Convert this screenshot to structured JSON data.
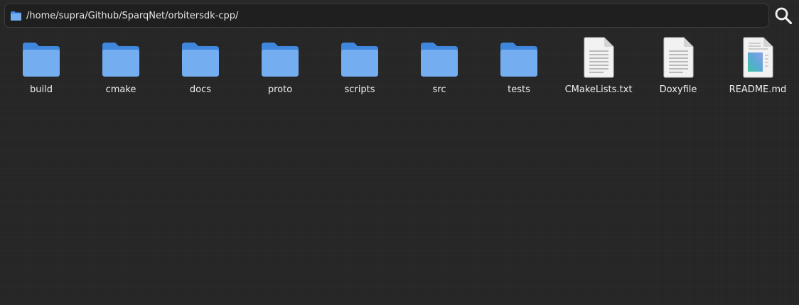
{
  "pathbar": {
    "path": "/home/supra/Github/SparqNet/orbitersdk-cpp/",
    "icon": "folder-icon"
  },
  "search": {
    "icon": "search-icon"
  },
  "items": [
    {
      "label": "build",
      "type": "folder"
    },
    {
      "label": "cmake",
      "type": "folder"
    },
    {
      "label": "docs",
      "type": "folder"
    },
    {
      "label": "proto",
      "type": "folder"
    },
    {
      "label": "scripts",
      "type": "folder"
    },
    {
      "label": "src",
      "type": "folder"
    },
    {
      "label": "tests",
      "type": "folder"
    },
    {
      "label": "CMakeLists.txt",
      "type": "text-file"
    },
    {
      "label": "Doxyfile",
      "type": "text-file"
    },
    {
      "label": "README.md",
      "type": "markdown-file"
    }
  ],
  "colors": {
    "background": "#262626",
    "folder_front": "#74aef0",
    "folder_back": "#3f86dd",
    "document": "#f2f2f2"
  }
}
